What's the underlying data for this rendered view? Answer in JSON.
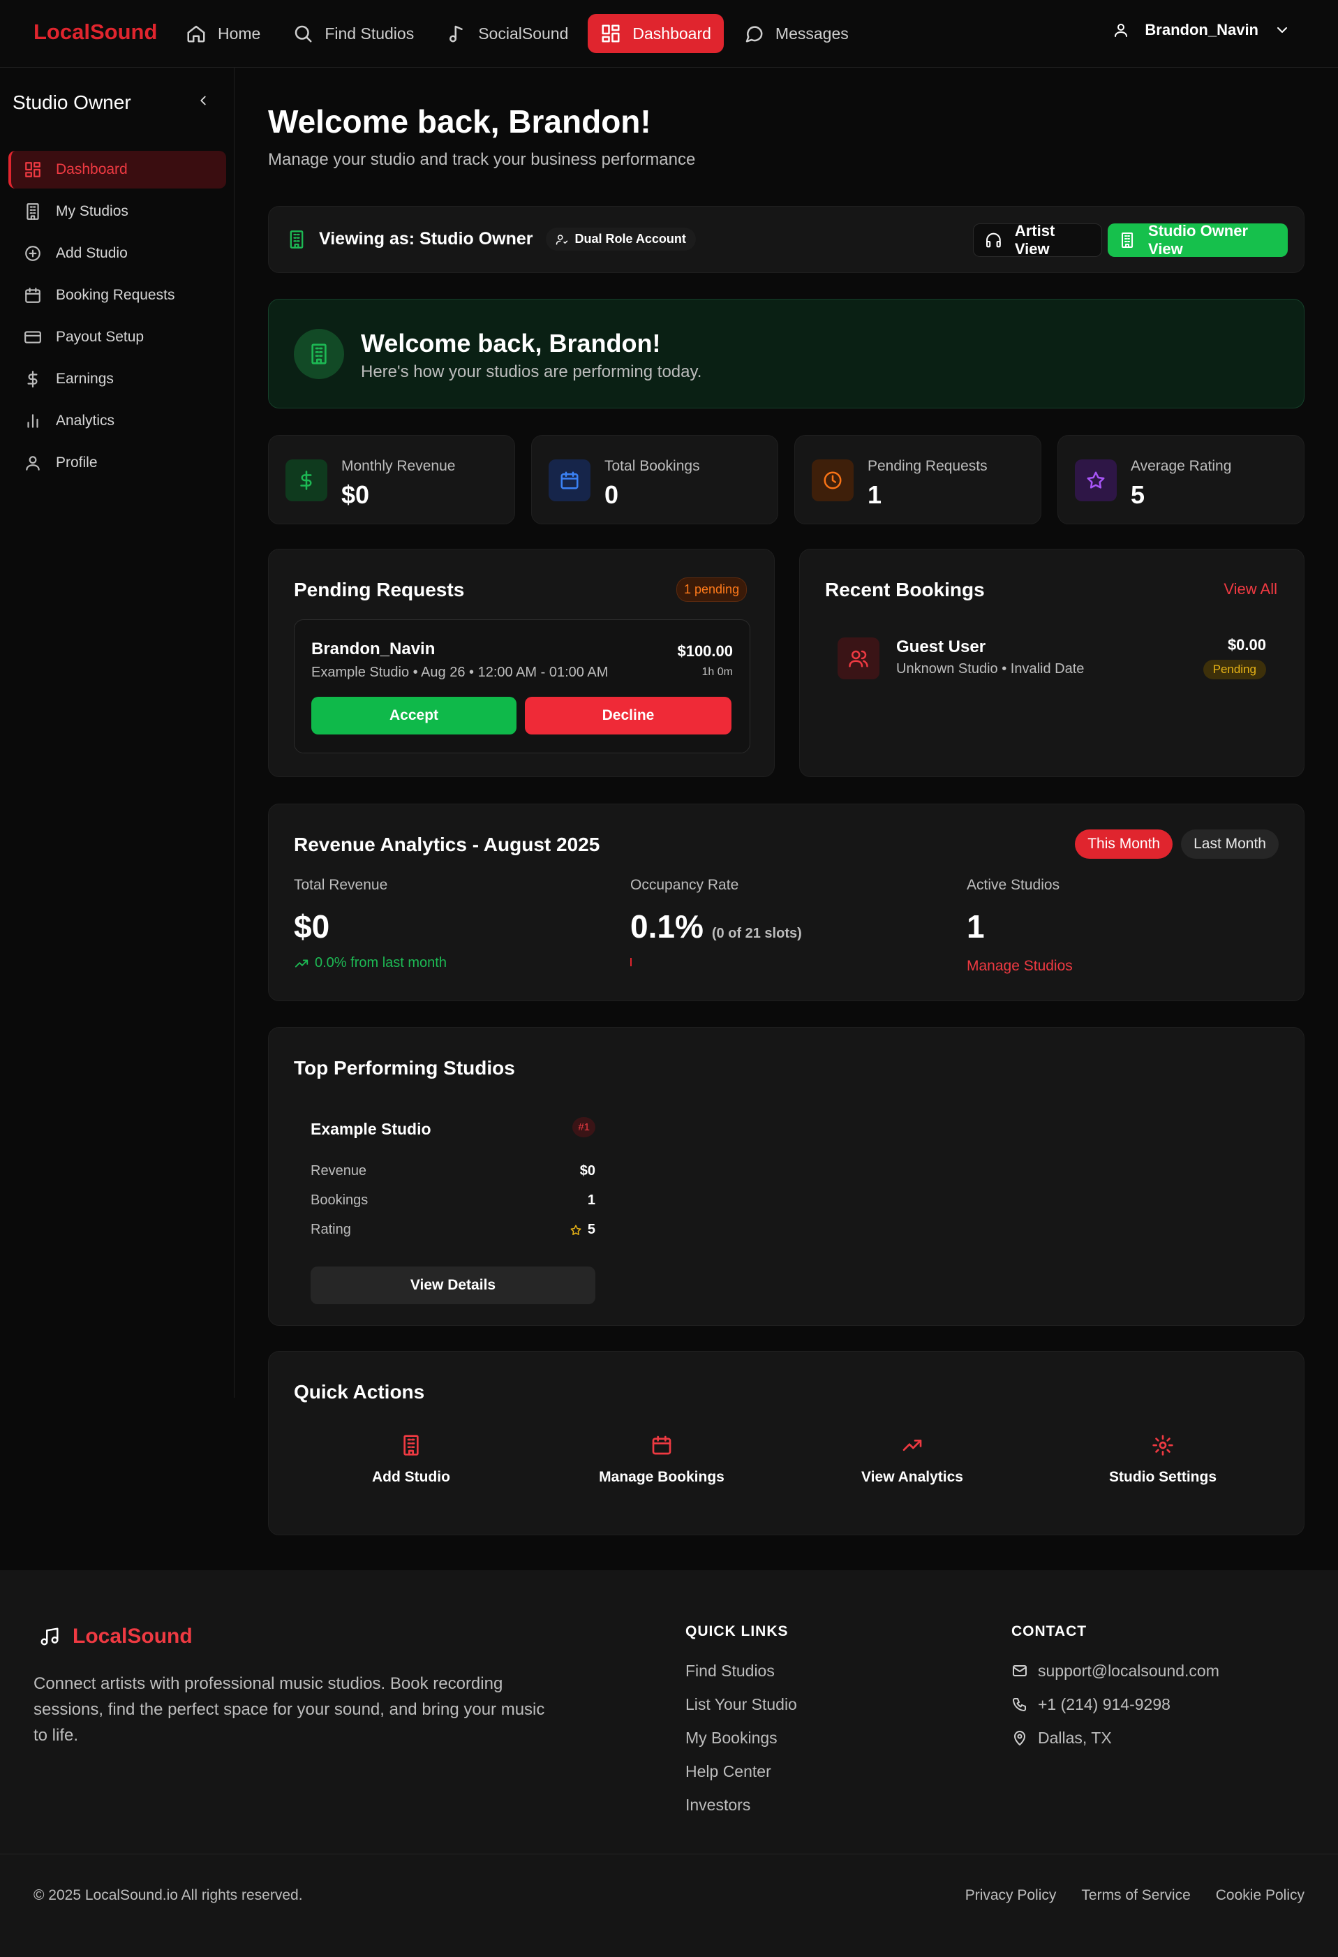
{
  "nav": {
    "logo": "LocalSound",
    "items": [
      {
        "label": "Home",
        "icon": "home-icon"
      },
      {
        "label": "Find Studios",
        "icon": "search-icon"
      },
      {
        "label": "SocialSound",
        "icon": "music-note-icon"
      },
      {
        "label": "Dashboard",
        "icon": "dashboard-icon",
        "active": true
      },
      {
        "label": "Messages",
        "icon": "message-icon"
      }
    ],
    "user": "Brandon_Navin"
  },
  "sidebar": {
    "title": "Studio Owner",
    "items": [
      {
        "label": "Dashboard",
        "icon": "dashboard-icon",
        "active": true
      },
      {
        "label": "My Studios",
        "icon": "building-icon"
      },
      {
        "label": "Add Studio",
        "icon": "plus-circle-icon"
      },
      {
        "label": "Booking Requests",
        "icon": "calendar-icon"
      },
      {
        "label": "Payout Setup",
        "icon": "credit-card-icon"
      },
      {
        "label": "Earnings",
        "icon": "dollar-icon"
      },
      {
        "label": "Analytics",
        "icon": "bar-chart-icon"
      },
      {
        "label": "Profile",
        "icon": "user-icon"
      }
    ]
  },
  "header": {
    "title": "Welcome back, Brandon!",
    "subtitle": "Manage your studio and track your business performance"
  },
  "view_bar": {
    "label": "Viewing as: Studio Owner",
    "badge": "Dual Role Account",
    "artist_btn": "Artist View",
    "owner_btn": "Studio Owner View"
  },
  "welcome": {
    "title": "Welcome back, Brandon!",
    "subtitle": "Here's how your studios are performing today."
  },
  "stats": [
    {
      "label": "Monthly Revenue",
      "value": "$0",
      "icon": "dollar-icon",
      "color": "#1db954"
    },
    {
      "label": "Total Bookings",
      "value": "0",
      "icon": "calendar-icon",
      "color": "#3b82f6"
    },
    {
      "label": "Pending Requests",
      "value": "1",
      "icon": "clock-icon",
      "color": "#f97316"
    },
    {
      "label": "Average Rating",
      "value": "5",
      "icon": "star-icon",
      "color": "#a855f7"
    }
  ],
  "pending": {
    "title": "Pending Requests",
    "badge": "1 pending",
    "request": {
      "name": "Brandon_Navin",
      "details": "Example Studio • Aug 26 • 12:00 AM - 01:00 AM",
      "price": "$100.00",
      "duration": "1h 0m",
      "accept": "Accept",
      "decline": "Decline"
    }
  },
  "recent": {
    "title": "Recent Bookings",
    "view_all": "View All",
    "booking": {
      "name": "Guest User",
      "details": "Unknown Studio • Invalid Date",
      "price": "$0.00",
      "status": "Pending"
    }
  },
  "revenue": {
    "title": "Revenue Analytics - August 2025",
    "tab_this": "This Month",
    "tab_last": "Last Month",
    "total_label": "Total Revenue",
    "total_value": "$0",
    "total_note": "0.0% from last month",
    "occ_label": "Occupancy Rate",
    "occ_value": "0.1%",
    "occ_detail": "(0 of 21 slots)",
    "active_label": "Active Studios",
    "active_value": "1",
    "active_link": "Manage Studios"
  },
  "top": {
    "title": "Top Performing Studios",
    "studio": {
      "name": "Example Studio",
      "rank": "#1",
      "revenue_label": "Revenue",
      "revenue": "$0",
      "bookings_label": "Bookings",
      "bookings": "1",
      "rating_label": "Rating",
      "rating": "5",
      "button": "View Details"
    }
  },
  "quick": {
    "title": "Quick Actions",
    "items": [
      {
        "label": "Add Studio",
        "icon": "building-icon"
      },
      {
        "label": "Manage Bookings",
        "icon": "calendar-icon"
      },
      {
        "label": "View Analytics",
        "icon": "trending-up-icon"
      },
      {
        "label": "Studio Settings",
        "icon": "gear-icon"
      }
    ]
  },
  "footer": {
    "logo": "LocalSound",
    "description": "Connect artists with professional music studios. Book recording sessions, find the perfect space for your sound, and bring your music to life.",
    "quick_links_title": "QUICK LINKS",
    "quick_links": [
      "Find Studios",
      "List Your Studio",
      "My Bookings",
      "Help Center",
      "Investors"
    ],
    "contact_title": "CONTACT",
    "contact": [
      {
        "label": "support@localsound.com",
        "icon": "mail-icon"
      },
      {
        "label": "+1 (214) 914-9298",
        "icon": "phone-icon"
      },
      {
        "label": "Dallas, TX",
        "icon": "map-pin-icon"
      }
    ],
    "copyright": "© 2025 LocalSound.io All rights reserved.",
    "legal": [
      "Privacy Policy",
      "Terms of Service",
      "Cookie Policy"
    ]
  }
}
